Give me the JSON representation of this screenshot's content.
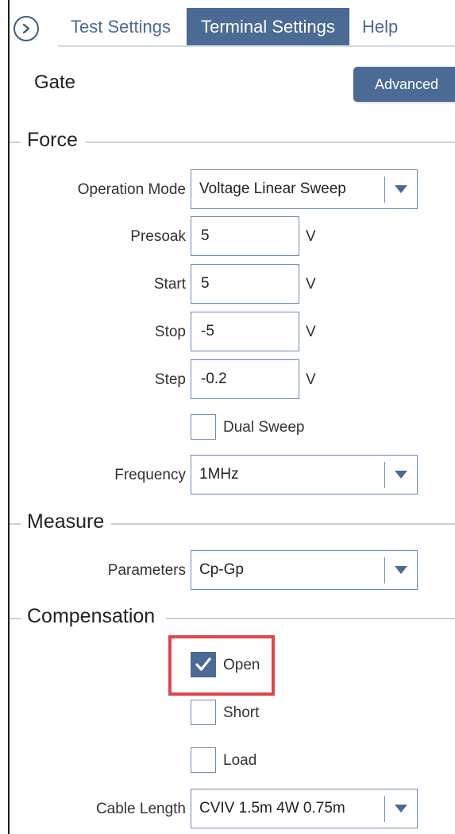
{
  "tabs": {
    "test_settings": "Test Settings",
    "terminal_settings": "Terminal Settings",
    "help": "Help"
  },
  "header": {
    "title": "Gate",
    "advanced_label": "Advanced"
  },
  "force": {
    "section_label": "Force",
    "operation_mode": {
      "label": "Operation Mode",
      "value": "Voltage Linear Sweep"
    },
    "presoak": {
      "label": "Presoak",
      "value": "5",
      "unit": "V"
    },
    "start": {
      "label": "Start",
      "value": "5",
      "unit": "V"
    },
    "stop": {
      "label": "Stop",
      "value": "-5",
      "unit": "V"
    },
    "step": {
      "label": "Step",
      "value": "-0.2",
      "unit": "V"
    },
    "dual_sweep": {
      "label": "Dual Sweep",
      "checked": false
    },
    "frequency": {
      "label": "Frequency",
      "value": "1MHz"
    }
  },
  "measure": {
    "section_label": "Measure",
    "parameters": {
      "label": "Parameters",
      "value": "Cp-Gp"
    }
  },
  "compensation": {
    "section_label": "Compensation",
    "open": {
      "label": "Open",
      "checked": true
    },
    "short": {
      "label": "Short",
      "checked": false
    },
    "load": {
      "label": "Load",
      "checked": false
    },
    "cable_length": {
      "label": "Cable Length",
      "value": "CVIV 1.5m 4W 0.75m"
    }
  },
  "colors": {
    "accent": "#4b6a94",
    "border": "#6d8bb1",
    "highlight": "#e0454a"
  },
  "icons": {
    "collapse": "chevron-right-circle-icon",
    "dropdown": "caret-down-icon",
    "check": "checkmark-icon"
  }
}
